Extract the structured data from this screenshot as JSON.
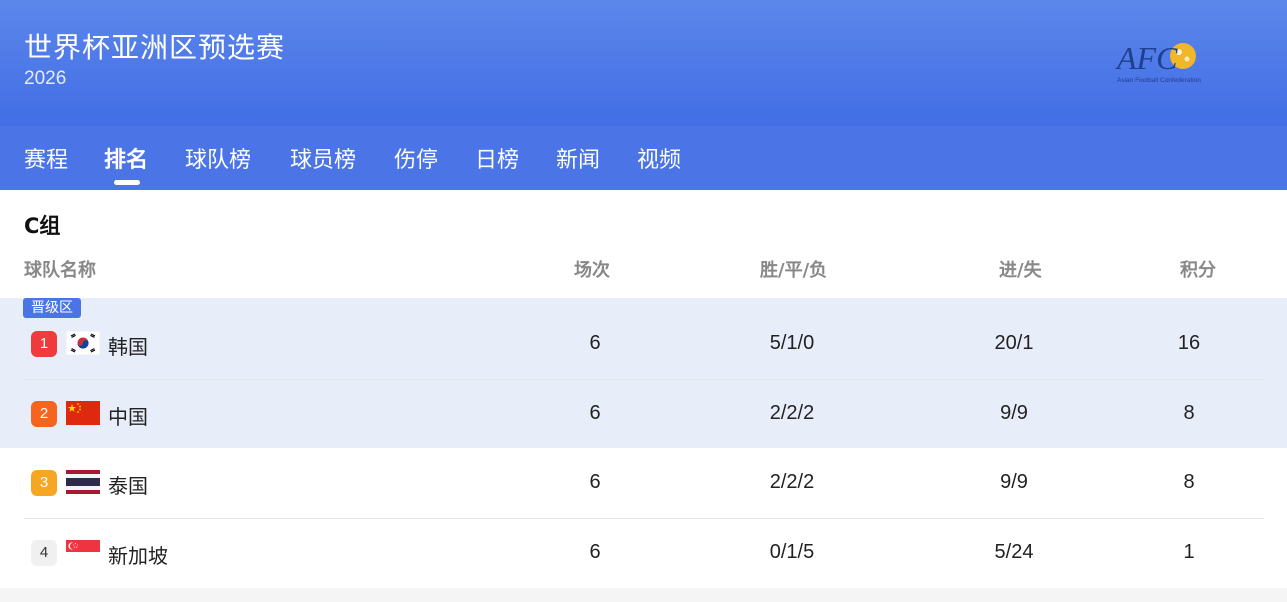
{
  "header": {
    "title": "世界杯亚洲区预选赛",
    "year": "2026",
    "logo_text": "AFC",
    "logo_sub": "Asian Football Confederation"
  },
  "tabs": [
    "赛程",
    "排名",
    "球队榜",
    "球员榜",
    "伤停",
    "日榜",
    "新闻",
    "视频"
  ],
  "active_tab": "排名",
  "group": {
    "title": "C组",
    "columns": {
      "team": "球队名称",
      "played": "场次",
      "wdl": "胜/平/负",
      "goals": "进/失",
      "points": "积分"
    },
    "zone_label": "晋级区",
    "rows": [
      {
        "rank": "1",
        "team": "韩国",
        "flag": "korea-flag-icon",
        "played": "6",
        "wdl": "5/1/0",
        "goals": "20/1",
        "points": "16",
        "rank_color": "#ef3b3b"
      },
      {
        "rank": "2",
        "team": "中国",
        "flag": "china-flag-icon",
        "played": "6",
        "wdl": "2/2/2",
        "goals": "9/9",
        "points": "8",
        "rank_color": "#f5651f"
      },
      {
        "rank": "3",
        "team": "泰国",
        "flag": "thailand-flag-icon",
        "played": "6",
        "wdl": "2/2/2",
        "goals": "9/9",
        "points": "8",
        "rank_color": "#f6a623"
      },
      {
        "rank": "4",
        "team": "新加坡",
        "flag": "singapore-flag-icon",
        "played": "6",
        "wdl": "0/1/5",
        "goals": "5/24",
        "points": "1",
        "rank_color": "#f0f0f0"
      }
    ]
  },
  "colors": {
    "header_bg": "#4b74e6",
    "zone_band": "#e8edfa",
    "zone_badge": "#4b74e6"
  }
}
